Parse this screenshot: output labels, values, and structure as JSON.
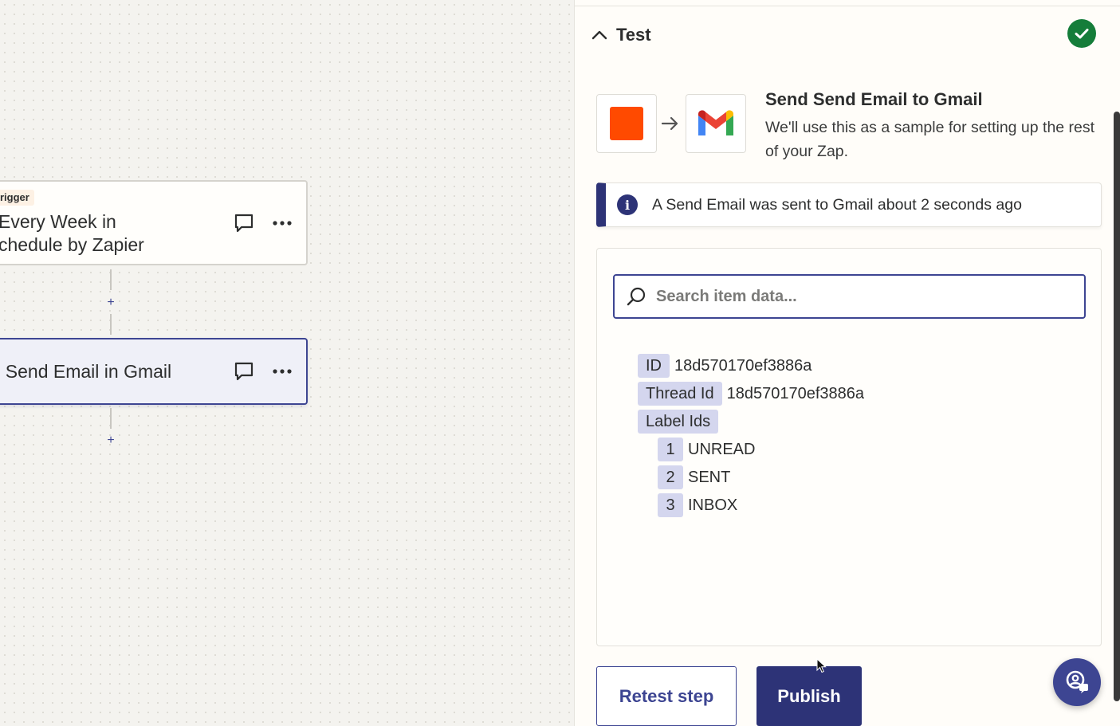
{
  "canvas": {
    "trigger_step": {
      "badge": "rigger",
      "title_line1": "Every Week in",
      "title_line2": "chedule by Zapier"
    },
    "action_step": {
      "title": ". Send Email in Gmail"
    },
    "plus_label": "+"
  },
  "panel": {
    "section_title": "Test",
    "sample": {
      "title": "Send Send Email to Gmail",
      "description": "We'll use this as a sample for setting up the rest of your Zap."
    },
    "info": {
      "icon": "i",
      "message": "A Send Email was sent to Gmail about 2 seconds ago"
    },
    "search": {
      "placeholder": "Search item data..."
    },
    "data": {
      "id_key": "ID",
      "id_value": "18d570170ef3886a",
      "thread_key": "Thread Id",
      "thread_value": "18d570170ef3886a",
      "labels_key": "Label Ids",
      "labels": [
        {
          "index": "1",
          "value": "UNREAD"
        },
        {
          "index": "2",
          "value": "SENT"
        },
        {
          "index": "3",
          "value": "INBOX"
        }
      ]
    },
    "buttons": {
      "retest": "Retest step",
      "publish": "Publish"
    }
  },
  "colors": {
    "accent": "#3d4592",
    "accent_dark": "#2d3377",
    "success": "#157d3a",
    "schedule_orange": "#ff4a00",
    "key_highlight": "#d4d6ee"
  },
  "icons": {
    "comment": "comment-icon",
    "more": "more-horizontal-icon",
    "collapse": "chevron-up-icon",
    "success": "check-circle-icon",
    "arrow": "arrow-right-icon",
    "info": "info-icon",
    "search": "search-icon",
    "help": "help-chat-icon"
  }
}
